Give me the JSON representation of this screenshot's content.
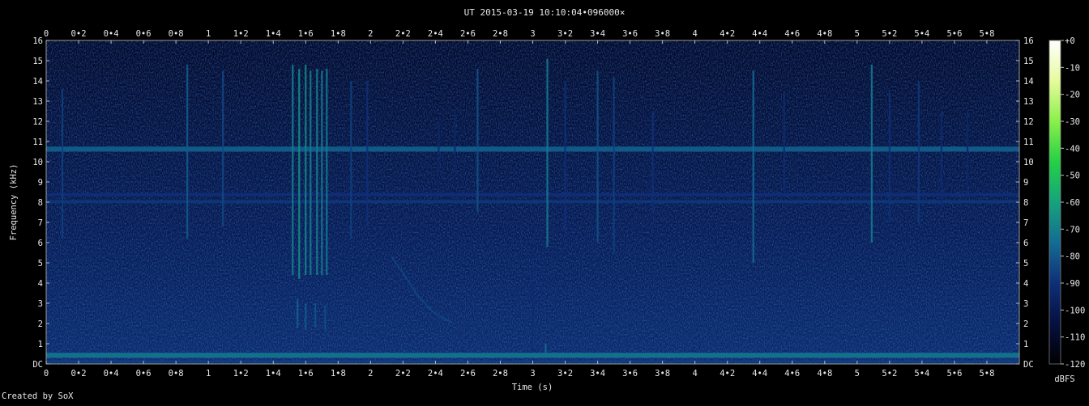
{
  "chart_data": {
    "type": "heatmap",
    "title": "UT 2015-03-19 10:10:04•096000×",
    "xlabel": "Time (s)",
    "ylabel": "Frequency (kHz)",
    "xlim": [
      0,
      6
    ],
    "ylim": [
      0,
      16
    ],
    "x_ticks": [
      {
        "v": 0,
        "label": "0"
      },
      {
        "v": 0.2,
        "label": "0•2"
      },
      {
        "v": 0.4,
        "label": "0•4"
      },
      {
        "v": 0.6,
        "label": "0•6"
      },
      {
        "v": 0.8,
        "label": "0•8"
      },
      {
        "v": 1,
        "label": "1"
      },
      {
        "v": 1.2,
        "label": "1•2"
      },
      {
        "v": 1.4,
        "label": "1•4"
      },
      {
        "v": 1.6,
        "label": "1•6"
      },
      {
        "v": 1.8,
        "label": "1•8"
      },
      {
        "v": 2,
        "label": "2"
      },
      {
        "v": 2.2,
        "label": "2•2"
      },
      {
        "v": 2.4,
        "label": "2•4"
      },
      {
        "v": 2.6,
        "label": "2•6"
      },
      {
        "v": 2.8,
        "label": "2•8"
      },
      {
        "v": 3,
        "label": "3"
      },
      {
        "v": 3.2,
        "label": "3•2"
      },
      {
        "v": 3.4,
        "label": "3•4"
      },
      {
        "v": 3.6,
        "label": "3•6"
      },
      {
        "v": 3.8,
        "label": "3•8"
      },
      {
        "v": 4,
        "label": "4"
      },
      {
        "v": 4.2,
        "label": "4•2"
      },
      {
        "v": 4.4,
        "label": "4•4"
      },
      {
        "v": 4.6,
        "label": "4•6"
      },
      {
        "v": 4.8,
        "label": "4•8"
      },
      {
        "v": 5,
        "label": "5"
      },
      {
        "v": 5.2,
        "label": "5•2"
      },
      {
        "v": 5.4,
        "label": "5•4"
      },
      {
        "v": 5.6,
        "label": "5•6"
      },
      {
        "v": 5.8,
        "label": "5•8"
      }
    ],
    "y_ticks": [
      {
        "v": 0,
        "label": "DC"
      },
      {
        "v": 1,
        "label": "1"
      },
      {
        "v": 2,
        "label": "2"
      },
      {
        "v": 3,
        "label": "3"
      },
      {
        "v": 4,
        "label": "4"
      },
      {
        "v": 5,
        "label": "5"
      },
      {
        "v": 6,
        "label": "6"
      },
      {
        "v": 7,
        "label": "7"
      },
      {
        "v": 8,
        "label": "8"
      },
      {
        "v": 9,
        "label": "9"
      },
      {
        "v": 10,
        "label": "10"
      },
      {
        "v": 11,
        "label": "11"
      },
      {
        "v": 12,
        "label": "12"
      },
      {
        "v": 13,
        "label": "13"
      },
      {
        "v": 14,
        "label": "14"
      },
      {
        "v": 15,
        "label": "15"
      },
      {
        "v": 16,
        "label": "16"
      }
    ],
    "colorbar": {
      "label": "dBFS",
      "range": [
        -120,
        0
      ],
      "ticks": [
        {
          "v": 0,
          "label": "+0"
        },
        {
          "v": -10,
          "label": "-10"
        },
        {
          "v": -20,
          "label": "-20"
        },
        {
          "v": -30,
          "label": "-30"
        },
        {
          "v": -40,
          "label": "-40"
        },
        {
          "v": -50,
          "label": "-50"
        },
        {
          "v": -60,
          "label": "-60"
        },
        {
          "v": -70,
          "label": "-70"
        },
        {
          "v": -80,
          "label": "-80"
        },
        {
          "v": -90,
          "label": "-90"
        },
        {
          "v": -100,
          "label": "-100"
        },
        {
          "v": -110,
          "label": "-110"
        },
        {
          "v": -120,
          "label": "-120"
        }
      ],
      "colors": [
        "#000000",
        "#061040",
        "#0f2f78",
        "#136c93",
        "#16a37c",
        "#25d046",
        "#8af04a",
        "#e6fb9c",
        "#ffffff"
      ]
    },
    "background_level_db": -100,
    "horizontal_bands": [
      {
        "f0": 0.08,
        "f1": 0.18,
        "db": -86
      },
      {
        "f0": 0.3,
        "f1": 0.55,
        "db": -72
      },
      {
        "f0": 10.5,
        "f1": 10.75,
        "db": -78
      },
      {
        "f0": 8.3,
        "f1": 8.45,
        "db": -90
      },
      {
        "f0": 7.95,
        "f1": 8.1,
        "db": -88
      }
    ],
    "vertical_streaks": [
      {
        "t": 0.1,
        "f0": 6.2,
        "f1": 13.6,
        "db": -86
      },
      {
        "t": 0.87,
        "f0": 6.2,
        "f1": 14.8,
        "db": -80
      },
      {
        "t": 1.09,
        "f0": 6.8,
        "f1": 14.5,
        "db": -84
      },
      {
        "t": 1.52,
        "f0": 4.4,
        "f1": 14.8,
        "db": -70
      },
      {
        "t": 1.56,
        "f0": 4.2,
        "f1": 14.6,
        "db": -66
      },
      {
        "t": 1.6,
        "f0": 4.4,
        "f1": 14.8,
        "db": -68
      },
      {
        "t": 1.63,
        "f0": 4.4,
        "f1": 14.5,
        "db": -70
      },
      {
        "t": 1.67,
        "f0": 4.4,
        "f1": 14.6,
        "db": -70
      },
      {
        "t": 1.7,
        "f0": 4.4,
        "f1": 14.5,
        "db": -72
      },
      {
        "t": 1.73,
        "f0": 4.4,
        "f1": 14.6,
        "db": -72
      },
      {
        "t": 1.88,
        "f0": 6.2,
        "f1": 14.0,
        "db": -86
      },
      {
        "t": 1.98,
        "f0": 6.8,
        "f1": 14.0,
        "db": -90
      },
      {
        "t": 2.42,
        "f0": 9.5,
        "f1": 12.0,
        "db": -94
      },
      {
        "t": 2.52,
        "f0": 9.5,
        "f1": 12.5,
        "db": -94
      },
      {
        "t": 2.66,
        "f0": 7.5,
        "f1": 14.6,
        "db": -82
      },
      {
        "t": 3.09,
        "f0": 5.8,
        "f1": 15.1,
        "db": -72
      },
      {
        "t": 3.2,
        "f0": 6.5,
        "f1": 14.0,
        "db": -90
      },
      {
        "t": 3.4,
        "f0": 6.0,
        "f1": 14.5,
        "db": -82
      },
      {
        "t": 3.5,
        "f0": 5.5,
        "f1": 14.2,
        "db": -86
      },
      {
        "t": 3.74,
        "f0": 7.5,
        "f1": 12.5,
        "db": -90
      },
      {
        "t": 4.36,
        "f0": 5.0,
        "f1": 14.5,
        "db": -76
      },
      {
        "t": 4.55,
        "f0": 8.5,
        "f1": 13.5,
        "db": -92
      },
      {
        "t": 5.09,
        "f0": 6.0,
        "f1": 14.8,
        "db": -72
      },
      {
        "t": 5.2,
        "f0": 7.0,
        "f1": 13.5,
        "db": -90
      },
      {
        "t": 5.38,
        "f0": 7.0,
        "f1": 14.0,
        "db": -88
      },
      {
        "t": 5.52,
        "f0": 7.5,
        "f1": 12.5,
        "db": -92
      },
      {
        "t": 5.68,
        "f0": 8.5,
        "f1": 12.5,
        "db": -94
      }
    ],
    "low_fragments": [
      {
        "t": 1.55,
        "f0": 1.8,
        "f1": 3.2,
        "db": -76
      },
      {
        "t": 1.6,
        "f0": 1.7,
        "f1": 3.0,
        "db": -78
      },
      {
        "t": 1.66,
        "f0": 1.8,
        "f1": 3.0,
        "db": -80
      },
      {
        "t": 1.72,
        "f0": 1.7,
        "f1": 2.9,
        "db": -82
      },
      {
        "t": 3.0,
        "f0": 0.6,
        "f1": 5.0,
        "db": -92
      },
      {
        "t": 3.08,
        "f0": 0.3,
        "f1": 1.0,
        "db": -74
      }
    ],
    "chirps": [
      {
        "points": [
          [
            2.13,
            5.3
          ],
          [
            2.2,
            4.5
          ],
          [
            2.28,
            3.5
          ],
          [
            2.38,
            2.6
          ],
          [
            2.5,
            2.05
          ]
        ],
        "db": -84
      }
    ]
  }
}
